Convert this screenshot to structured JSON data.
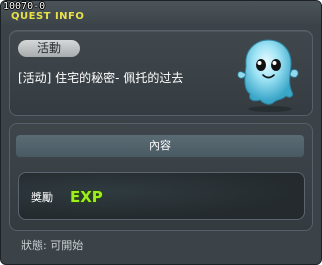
{
  "window": {
    "id": "10070-0",
    "title": "QUEST INFO"
  },
  "quest": {
    "category_badge": "活動",
    "title": "[活动] 住宅的秘密- 佩托的过去",
    "npc_icon": "ghost-npc-icon"
  },
  "content": {
    "header": "內容",
    "reward_label": "獎勵",
    "reward_icon": "exp-icon",
    "reward_text": "EXP"
  },
  "status": {
    "text": "狀態: 可開始"
  },
  "colors": {
    "title_yellow": "#e8e04a",
    "exp_green": "#9cef1a",
    "panel_bg": "#3b4348"
  }
}
